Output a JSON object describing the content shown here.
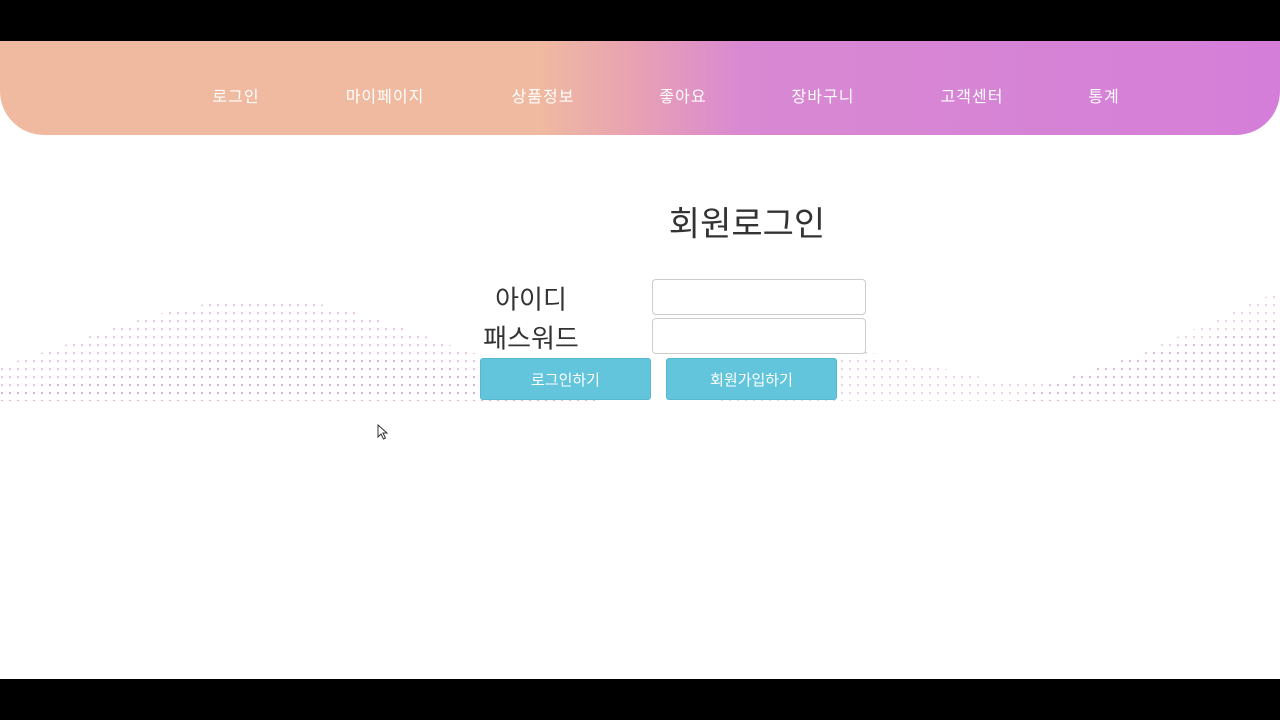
{
  "nav": {
    "items": [
      {
        "label": "로그인"
      },
      {
        "label": "마이페이지"
      },
      {
        "label": "상품정보"
      },
      {
        "label": "좋아요"
      },
      {
        "label": "장바구니"
      },
      {
        "label": "고객센터"
      },
      {
        "label": "통계"
      }
    ]
  },
  "login": {
    "title": "회원로그인",
    "id_label": "아이디",
    "id_value": "",
    "password_label": "패스워드",
    "password_value": "",
    "login_button": "로그인하기",
    "signup_button": "회원가입하기"
  },
  "colors": {
    "nav_gradient_start": "#efbaa0",
    "nav_gradient_end": "#d57ed9",
    "button": "#63c5dc",
    "wave_dots": "#dcaad6",
    "letterbox": "#000000"
  }
}
